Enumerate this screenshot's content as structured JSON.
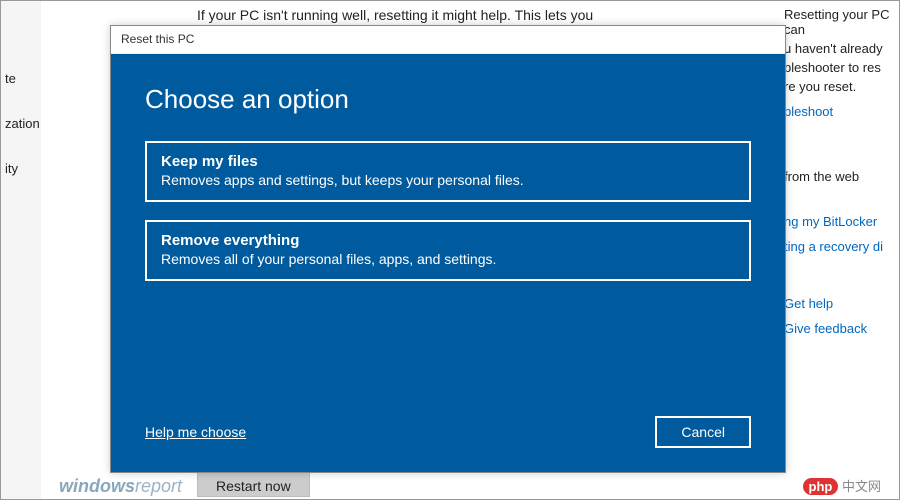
{
  "background": {
    "sidebar_items": [
      "te",
      "zation",
      "ity"
    ],
    "description": "If your PC isn't running well, resetting it might help. This lets you",
    "restart_button": "Restart now",
    "right_paras": [
      "Resetting your PC can",
      "u haven't already",
      "bleshooter to res",
      "re you reset."
    ],
    "right_links": [
      "bleshoot",
      "from the web",
      "ng my BitLocker",
      "ting a recovery di",
      "Get help",
      "Give feedback"
    ]
  },
  "dialog": {
    "title": "Reset this PC",
    "heading": "Choose an option",
    "options": [
      {
        "title": "Keep my files",
        "desc": "Removes apps and settings, but keeps your personal files."
      },
      {
        "title": "Remove everything",
        "desc": "Removes all of your personal files, apps, and settings."
      }
    ],
    "help_link": "Help me choose",
    "cancel": "Cancel"
  },
  "watermarks": {
    "w1a": "windows",
    "w1b": "report",
    "w2_brand": "php",
    "w2_text": " 中文网"
  }
}
